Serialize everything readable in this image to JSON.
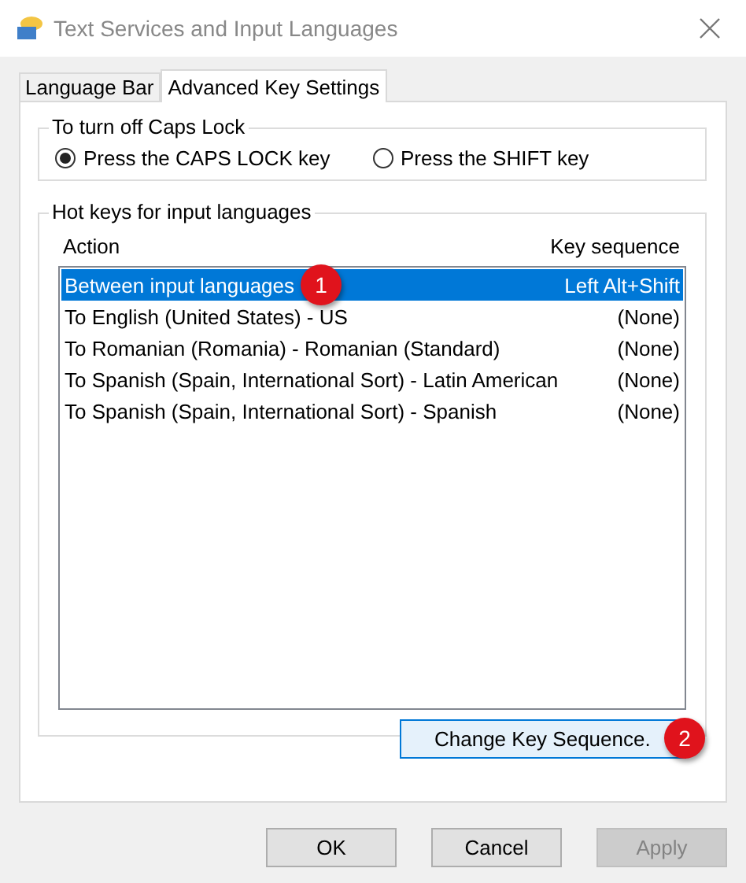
{
  "window": {
    "title": "Text Services and Input Languages"
  },
  "tabs": [
    {
      "label": "Language Bar",
      "selected": false
    },
    {
      "label": "Advanced Key Settings",
      "selected": true
    }
  ],
  "caps_lock": {
    "title": "To turn off Caps Lock",
    "options": [
      {
        "label": "Press the CAPS LOCK key",
        "selected": true
      },
      {
        "label": "Press the SHIFT key",
        "selected": false
      }
    ]
  },
  "hot_keys": {
    "title": "Hot keys for input languages",
    "columns": [
      "Action",
      "Key sequence"
    ],
    "rows": [
      {
        "action": "Between input languages",
        "keys": "Left Alt+Shift",
        "selected": true,
        "badge": "1"
      },
      {
        "action": "To English (United States) - US",
        "keys": "(None)",
        "selected": false
      },
      {
        "action": "To Romanian (Romania) - Romanian (Standard)",
        "keys": "(None)",
        "selected": false
      },
      {
        "action": "To Spanish (Spain, International Sort) - Latin American",
        "keys": "(None)",
        "selected": false
      },
      {
        "action": "To Spanish (Spain, International Sort) - Spanish",
        "keys": "(None)",
        "selected": false
      }
    ],
    "change_button": {
      "label": "Change Key Sequence.",
      "badge": "2"
    }
  },
  "buttons": [
    {
      "label": "OK",
      "disabled": false
    },
    {
      "label": "Cancel",
      "disabled": false
    },
    {
      "label": "Apply",
      "disabled": true
    }
  ]
}
